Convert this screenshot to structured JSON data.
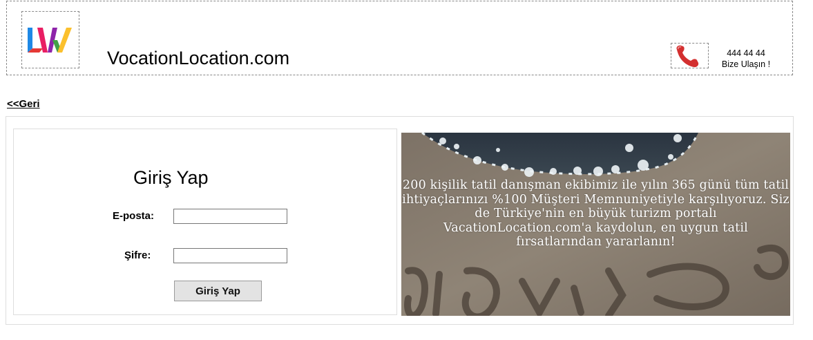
{
  "header": {
    "site_title": "VocationLocation.com",
    "logo_icon": "lv-logo-icon",
    "phone_icon": "phone-icon",
    "phone_number": "444 44 44",
    "contact_label": "Bize Ulaşın !"
  },
  "nav": {
    "back_label": "<<Geri"
  },
  "login": {
    "title": "Giriş Yap",
    "email_label": "E-posta:",
    "email_value": "",
    "password_label": "Şifre:",
    "password_value": "",
    "submit_label": "Giriş Yap"
  },
  "promo": {
    "text": "200 kişilik tatil danışman ekibimiz ile yılın 365 günü tüm tatil ihtiyaçlarınızı %100 Müşteri Memnuniyetiyle karşılıyoruz. Siz de Türkiye'nin en büyük turizm portalı VacationLocation.com'a kaydolun, en uygun tatil fırsatlarından yararlanın!",
    "image_lettering": "HOLIDAY"
  }
}
